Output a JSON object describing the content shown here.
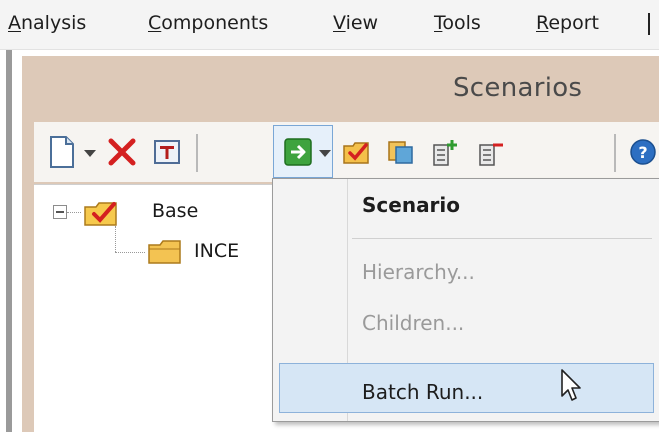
{
  "menubar": {
    "items": [
      {
        "label": "Analysis",
        "mnemonic": "A"
      },
      {
        "label": "Components",
        "mnemonic": "C"
      },
      {
        "label": "View",
        "mnemonic": "V"
      },
      {
        "label": "Tools",
        "mnemonic": "T"
      },
      {
        "label": "Report",
        "mnemonic": "R"
      }
    ]
  },
  "window": {
    "title": "Scenarios"
  },
  "toolbar": {
    "buttons": [
      {
        "name": "new-icon"
      },
      {
        "name": "delete-icon"
      },
      {
        "name": "rename-icon"
      },
      {
        "name": "run-icon"
      },
      {
        "name": "make-current-icon"
      },
      {
        "name": "compare-icon"
      },
      {
        "name": "add-child-icon"
      },
      {
        "name": "remove-child-icon"
      },
      {
        "name": "help-icon"
      }
    ]
  },
  "tree": {
    "root": {
      "label": "Base",
      "icon": "checked-folder-icon"
    },
    "child": {
      "label": "INCE",
      "icon": "folder-icon"
    }
  },
  "dropdown": {
    "items": [
      {
        "label": "Scenario",
        "bold": true,
        "enabled": true
      },
      {
        "label": "Hierarchy...",
        "enabled": false
      },
      {
        "label": "Children...",
        "enabled": false
      },
      {
        "label": "Batch Run...",
        "enabled": true,
        "highlighted": true
      }
    ]
  },
  "colors": {
    "window_bg": "#ddc9b8",
    "highlight": "#d6e6f5",
    "disabled_text": "#9a9a9a"
  }
}
